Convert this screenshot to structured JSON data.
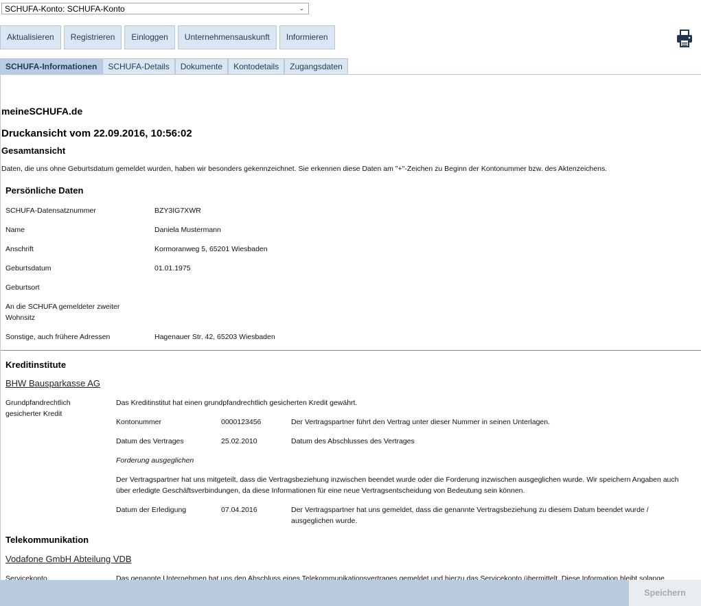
{
  "account_select": {
    "value": "SCHUFA-Konto: SCHUFA-Konto"
  },
  "toolbar": {
    "buttons": [
      "Aktualisieren",
      "Registrieren",
      "Einloggen",
      "Unternehmensauskunft",
      "Informieren"
    ]
  },
  "icons": {
    "print": "printer-icon",
    "dropdown": "chevron-down-icon"
  },
  "tabs": [
    "SCHUFA-Informationen",
    "SCHUFA-Details",
    "Dokumente",
    "Kontodetails",
    "Zugangsdaten"
  ],
  "doc": {
    "site": "meineSCHUFA.de",
    "print_title": "Druckansicht vom 22.09.2016, 10:56:02",
    "overview": "Gesamtansicht",
    "note": "Daten, die uns ohne Geburtsdatum gemeldet wurden, haben wir besonders gekennzeichnet. Sie erkennen diese Daten am \"+\"-Zeichen zu Beginn der Kontonummer bzw. des Aktenzeichens.",
    "personal": {
      "title": "Persönliche Daten",
      "rows": [
        {
          "label": "SCHUFA-Datensatznummer",
          "value": "BZY3IG7XWR"
        },
        {
          "label": "Name",
          "value": "Daniela Mustermann"
        },
        {
          "label": "Anschrift",
          "value": "Kormoranweg 5, 65201 Wiesbaden"
        },
        {
          "label": "Geburtsdatum",
          "value": "01.01.1975"
        },
        {
          "label": "Geburtsort",
          "value": ""
        },
        {
          "label_line1": "An die SCHUFA gemeldeter zweiter",
          "label_line2": "Wohnsitz",
          "value": ""
        },
        {
          "label": "Sonstige, auch frühere Adressen",
          "value": "Hagenauer Str. 42, 65203 Wiesbaden"
        }
      ]
    },
    "credit": {
      "title": "Kreditinstitute",
      "company": "BHW Bausparkasse AG",
      "type_line1": "Grundpfandrechtlich",
      "type_line2": "gesicherter Kredit",
      "intro": "Das Kreditinstitut hat einen grundpfandrechtlich gesicherten Kredit gewährt.",
      "account_label": "Kontonummer",
      "account_value": "0000123456",
      "account_desc": "Der Vertragspartner führt den Vertrag unter dieser Nummer in seinen Unterlagen.",
      "contract_date_label": "Datum des Vertrages",
      "contract_date_value": "25.02.2010",
      "contract_date_desc": "Datum des Abschlusses des Vertrages",
      "settled": "Forderung ausgeglichen",
      "settled_desc_line1": "Der Vertragspartner hat uns mitgeteilt, dass die Vertragsbeziehung inzwischen beendet wurde oder die Forderung inzwischen ausgeglichen wurde. Wir speichern Angaben auch",
      "settled_desc_line2": "über erledigte Geschäftsverbindungen, da diese Informationen für eine neue Vertragsentscheidung von Bedeutung sein können.",
      "completion_label": "Datum der Erledigung",
      "completion_value": "07.04.2016",
      "completion_desc_line1": "Der Vertragspartner hat uns gemeldet, dass die genannte Vertragsbeziehung zu diesem Datum beendet wurde /",
      "completion_desc_line2": "ausgeglichen wurde."
    },
    "telecom": {
      "title": "Telekommunikation",
      "company": "Vodafone GmbH Abteilung VDB",
      "type": "Servicekonto",
      "desc": "Das genannte Unternehmen hat uns den Abschluss eines Telekommunikationsvertrages gemeldet und hierzu das Servicekonto übermittelt. Diese Information bleibt solange"
    }
  },
  "footer": {
    "save_label": "Speichern"
  }
}
